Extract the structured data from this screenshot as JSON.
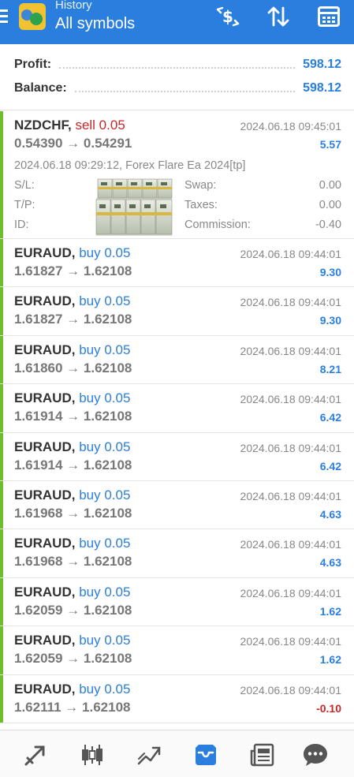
{
  "header": {
    "subtitle": "History",
    "title": "All symbols",
    "icons": [
      "menu-icon",
      "dollar-exchange-icon",
      "sort-icon",
      "calendar-icon"
    ]
  },
  "summary": {
    "profit_label": "Profit:",
    "profit_value": "598.12",
    "balance_label": "Balance:",
    "balance_value": "598.12"
  },
  "trades": [
    {
      "symbol": "NZDCHF,",
      "direction": "sell 0.05",
      "prices": "0.54390 → 0.54291",
      "time": "2024.06.18 09:45:01",
      "profit": "5.57",
      "detail": "2024.06.18 09:29:12, Forex Flare Ea 2024[tp]",
      "sl_label": "S/L:",
      "tp_label": "T/P:",
      "id_label": "ID:",
      "swap_label": "Swap:",
      "swap_value": "0.00",
      "taxes_label": "Taxes:",
      "taxes_value": "0.00",
      "commission_label": "Commission:",
      "commission_value": "-0.40"
    },
    {
      "symbol": "EURAUD,",
      "direction": "buy 0.05",
      "prices": "1.61827 → 1.62108",
      "time": "2024.06.18 09:44:01",
      "profit": "9.30"
    },
    {
      "symbol": "EURAUD,",
      "direction": "buy 0.05",
      "prices": "1.61827 → 1.62108",
      "time": "2024.06.18 09:44:01",
      "profit": "9.30"
    },
    {
      "symbol": "EURAUD,",
      "direction": "buy 0.05",
      "prices": "1.61860 → 1.62108",
      "time": "2024.06.18 09:44:01",
      "profit": "8.21"
    },
    {
      "symbol": "EURAUD,",
      "direction": "buy 0.05",
      "prices": "1.61914 → 1.62108",
      "time": "2024.06.18 09:44:01",
      "profit": "6.42"
    },
    {
      "symbol": "EURAUD,",
      "direction": "buy 0.05",
      "prices": "1.61914 → 1.62108",
      "time": "2024.06.18 09:44:01",
      "profit": "6.42"
    },
    {
      "symbol": "EURAUD,",
      "direction": "buy 0.05",
      "prices": "1.61968 → 1.62108",
      "time": "2024.06.18 09:44:01",
      "profit": "4.63"
    },
    {
      "symbol": "EURAUD,",
      "direction": "buy 0.05",
      "prices": "1.61968 → 1.62108",
      "time": "2024.06.18 09:44:01",
      "profit": "4.63"
    },
    {
      "symbol": "EURAUD,",
      "direction": "buy 0.05",
      "prices": "1.62059 → 1.62108",
      "time": "2024.06.18 09:44:01",
      "profit": "1.62"
    },
    {
      "symbol": "EURAUD,",
      "direction": "buy 0.05",
      "prices": "1.62059 → 1.62108",
      "time": "2024.06.18 09:44:01",
      "profit": "1.62"
    },
    {
      "symbol": "EURAUD,",
      "direction": "buy 0.05",
      "prices": "1.62111 → 1.62108",
      "time": "2024.06.18 09:44:01",
      "profit": "-0.10"
    }
  ],
  "bottom_nav": {
    "items": [
      "trade-icon",
      "chart-icon",
      "analytics-icon",
      "history-icon",
      "news-icon",
      "chat-icon"
    ],
    "active": "history-icon"
  },
  "colors": {
    "header_bg": "#2a7fde",
    "accent": "#2a7fde",
    "sell": "#c62828",
    "trade_marker": "#6cbf2a"
  }
}
